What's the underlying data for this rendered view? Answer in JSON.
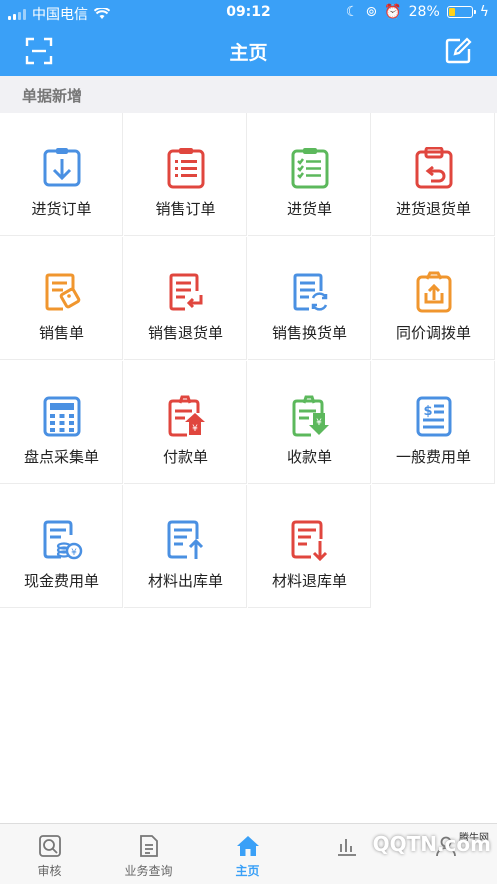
{
  "status": {
    "carrier": "中国电信",
    "time": "09:12",
    "battery": "28%",
    "battery_level": 0.28
  },
  "header": {
    "title": "主页",
    "left_icon": "scan-icon",
    "right_icon": "edit-icon"
  },
  "section": {
    "title": "单据新增"
  },
  "items": [
    {
      "label": "进货订单",
      "icon": "download-clipboard-icon",
      "color": "#4a90e2"
    },
    {
      "label": "销售订单",
      "icon": "list-clipboard-icon",
      "color": "#e0463e"
    },
    {
      "label": "进货单",
      "icon": "checklist-icon",
      "color": "#5cb85c"
    },
    {
      "label": "进货退货单",
      "icon": "return-clipboard-icon",
      "color": "#e0463e"
    },
    {
      "label": "销售单",
      "icon": "sales-doc-icon",
      "color": "#f0962e"
    },
    {
      "label": "销售退货单",
      "icon": "sales-return-icon",
      "color": "#e0463e"
    },
    {
      "label": "销售换货单",
      "icon": "exchange-doc-icon",
      "color": "#4a90e2"
    },
    {
      "label": "同价调拨单",
      "icon": "transfer-clipboard-icon",
      "color": "#f0962e"
    },
    {
      "label": "盘点采集单",
      "icon": "calculator-icon",
      "color": "#4a90e2"
    },
    {
      "label": "付款单",
      "icon": "payment-icon",
      "color": "#e0463e"
    },
    {
      "label": "收款单",
      "icon": "receipt-icon",
      "color": "#5cb85c"
    },
    {
      "label": "一般费用单",
      "icon": "expense-doc-icon",
      "color": "#4a90e2"
    },
    {
      "label": "现金费用单",
      "icon": "cash-expense-icon",
      "color": "#4a90e2"
    },
    {
      "label": "材料出库单",
      "icon": "material-out-icon",
      "color": "#4a90e2"
    },
    {
      "label": "材料退库单",
      "icon": "material-return-icon",
      "color": "#e0463e"
    }
  ],
  "tabs": [
    {
      "label": "审核",
      "icon": "audit-icon",
      "active": false
    },
    {
      "label": "业务查询",
      "icon": "query-icon",
      "active": false
    },
    {
      "label": "主页",
      "icon": "home-icon",
      "active": true
    },
    {
      "label": "",
      "icon": "report-icon",
      "active": false
    },
    {
      "label": "",
      "icon": "profile-icon",
      "active": false
    }
  ],
  "watermark": {
    "text": "QQTN.com",
    "small": "腾牛网"
  }
}
